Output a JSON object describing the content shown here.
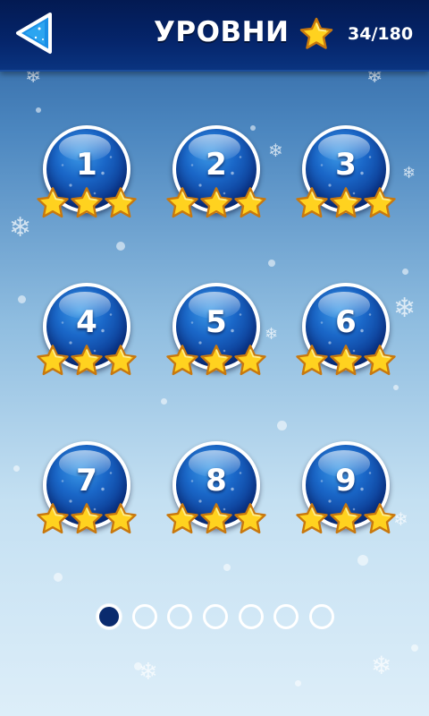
{
  "header": {
    "title": "УРОВНИ",
    "score": "34/180",
    "back_icon": "back-arrow-icon",
    "star_icon": "star-icon"
  },
  "colors": {
    "header_bg": "#05256b",
    "orb": "#1a67c8",
    "star_fill": "#ffd21f",
    "star_outline": "#c8780e",
    "dot_active": "#0a2b6e"
  },
  "levels": [
    {
      "number": "1",
      "stars": 3
    },
    {
      "number": "2",
      "stars": 3
    },
    {
      "number": "3",
      "stars": 3
    },
    {
      "number": "4",
      "stars": 3
    },
    {
      "number": "5",
      "stars": 3
    },
    {
      "number": "6",
      "stars": 3
    },
    {
      "number": "7",
      "stars": 3
    },
    {
      "number": "8",
      "stars": 3
    },
    {
      "number": "9",
      "stars": 3
    }
  ],
  "pagination": {
    "pages": 7,
    "current": 1
  }
}
